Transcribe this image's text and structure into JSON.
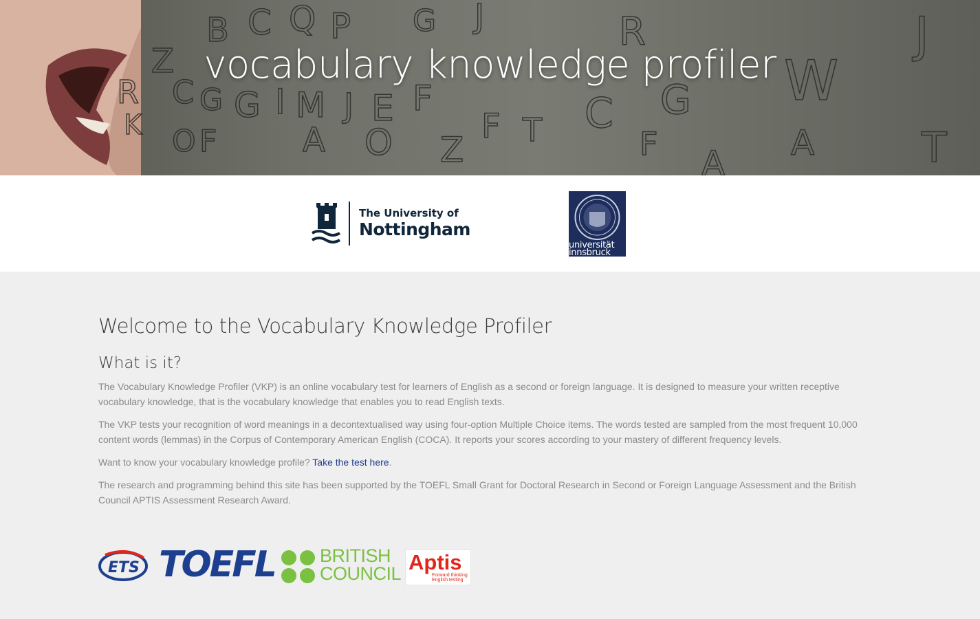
{
  "hero": {
    "title": "vocabulary knowledge profiler"
  },
  "partners": {
    "nottingham": {
      "line1": "The University of",
      "line2": "Nottingham"
    },
    "innsbruck": {
      "line1": "universität",
      "line2": "innsbruck"
    }
  },
  "main": {
    "heading": "Welcome to the Vocabulary Knowledge Profiler",
    "subheading": "What is it?",
    "paragraph1": "The Vocabulary Knowledge Profiler (VKP) is an online vocabulary test for learners of English as a second or foreign language. It is designed to measure your written receptive vocabulary knowledge, that is the vocabulary knowledge that enables you to read English texts.",
    "paragraph2": "The VKP tests your recognition of word meanings in a decontextualised way using four-option Multiple Choice items. The words tested are sampled from the most frequent 10,000 content words (lemmas) in the Corpus of Contemporary American English (COCA). It reports your scores according to your mastery of different frequency levels.",
    "cta_prefix": "Want to know your vocabulary knowledge profile? ",
    "cta_link": "Take the test here",
    "cta_suffix": ".",
    "paragraph4": "The research and programming behind this site has been supported by the TOEFL Small Grant for Doctoral Research in Second or Foreign Language Assessment and the British Council APTIS Assessment Research Award."
  },
  "sponsors": {
    "ets": "ETS",
    "toefl": "TOEFL",
    "british_council_line1": "BRITISH",
    "british_council_line2": "COUNCIL",
    "aptis": "Aptis",
    "aptis_tag_line1": "Forward thinking",
    "aptis_tag_line2": "English testing"
  },
  "colors": {
    "link": "#1f3d8a",
    "toefl_blue": "#1d3f8f",
    "british_council_green": "#7ac142",
    "aptis_red": "#e1261c",
    "innsbruck_navy": "#1e2e5c"
  }
}
